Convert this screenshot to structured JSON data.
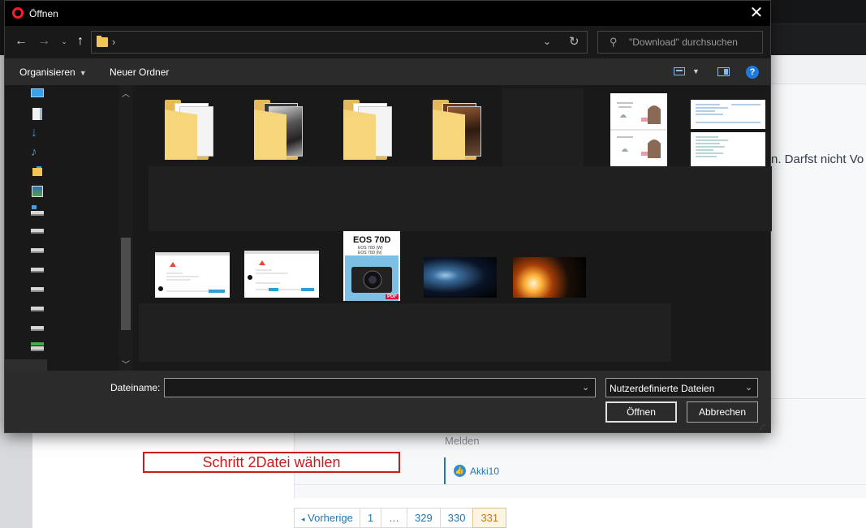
{
  "dialog": {
    "title": "Öffnen",
    "search_placeholder": "\"Download\" durchsuchen",
    "toolbar": {
      "organize": "Organisieren",
      "new_folder": "Neuer Ordner"
    },
    "filename_label": "Dateiname:",
    "filename_value": "",
    "filetype_value": "Nutzerdefinierte Dateien",
    "open_button": "Öffnen",
    "cancel_button": "Abbrechen",
    "nav_icons": [
      "desktop-icon",
      "documents-icon",
      "downloads-icon",
      "music-icon",
      "folder-icon",
      "pictures-icon",
      "network-drive-icon",
      "drive-icon",
      "drive-icon",
      "drive-icon",
      "drive-icon",
      "drive-icon",
      "drive-icon",
      "green-drive-icon",
      "green-drive-icon",
      "drive-icon"
    ],
    "files_row1": [
      {
        "kind": "folder"
      },
      {
        "kind": "folder-photo"
      },
      {
        "kind": "folder"
      },
      {
        "kind": "folder-photo"
      },
      {
        "kind": "blank"
      },
      {
        "kind": "sketch-image"
      },
      {
        "kind": "document-image"
      }
    ],
    "files_row2": [
      {
        "kind": "screenshot"
      },
      {
        "kind": "screenshot"
      },
      {
        "kind": "pdf-cover",
        "cover_title": "EOS 70D",
        "cover_sub1": "EOS 70D (W)",
        "cover_sub2": "EOS 70D (N)",
        "badge": "PDF"
      },
      {
        "kind": "space-image"
      },
      {
        "kind": "space-image"
      }
    ]
  },
  "page": {
    "partial_text": "n. Darfst nicht Vo",
    "report_link": "Melden",
    "like_user": "Akki10",
    "annotation": "Schritt 2Datei wählen",
    "pagination": {
      "prev": "Vorherige",
      "pages": [
        "1",
        "…",
        "329",
        "330",
        "331"
      ],
      "current": "331"
    }
  },
  "colors": {
    "accent_blue": "#2577b1",
    "annotation_red": "#cc1b1b",
    "dialog_dark": "#191919",
    "help_blue": "#1b7ae0"
  }
}
